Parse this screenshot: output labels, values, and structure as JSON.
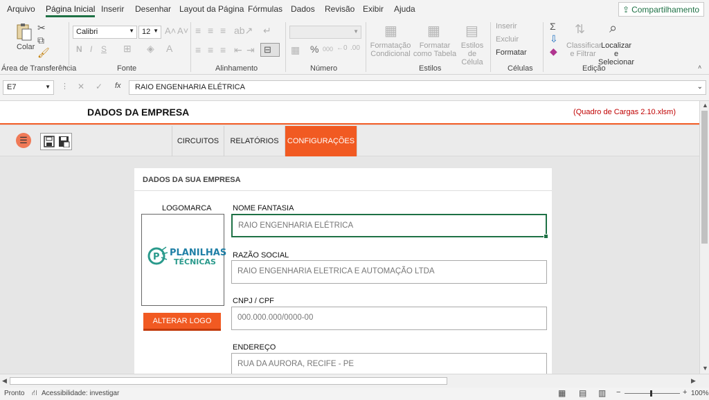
{
  "ribbon_tabs": [
    "Arquivo",
    "Página Inicial",
    "Inserir",
    "Desenhar",
    "Layout da Página",
    "Fórmulas",
    "Dados",
    "Revisão",
    "Exibir",
    "Ajuda"
  ],
  "share_label": "Compartilhamento",
  "clipboard": {
    "paste": "Colar",
    "group": "Área de Transferência"
  },
  "font": {
    "name": "Calibri",
    "size": "12",
    "group": "Fonte",
    "bold": "N",
    "italic": "I",
    "underline": "S"
  },
  "alignment": {
    "group": "Alinhamento"
  },
  "number": {
    "group": "Número",
    "percent": "%",
    "thousands": "000"
  },
  "styles": {
    "group": "Estilos",
    "conditional": "Formatação Condicional",
    "table": "Formatar como Tabela",
    "cell_styles": "Estilos de Célula"
  },
  "cells": {
    "group": "Células",
    "insert": "Inserir",
    "delete": "Excluir",
    "format": "Formatar"
  },
  "editing": {
    "group": "Edição",
    "sort": "Classificar e Filtrar",
    "find": "Localizar e Selecionar"
  },
  "formula_bar": {
    "cell": "E7",
    "fx": "fx",
    "value": "RAIO ENGENHARIA ELÉTRICA"
  },
  "sheet": {
    "title": "DADOS DA EMPRESA",
    "file_name": "(Quadro de Cargas 2.10.xlsm)",
    "nav_tabs": [
      "CIRCUITOS",
      "RELATÓRIOS",
      "CONFIGURAÇÕES"
    ],
    "active_tab": "CONFIGURAÇÕES",
    "card_title": "DADOS DA SUA EMPRESA",
    "logo_label": "LOGOMARCA",
    "logo_text_1": "PLANILHAS",
    "logo_text_2": "TÉCNICAS",
    "alter_logo": "ALTERAR LOGO",
    "fields": [
      {
        "label": "NOME FANTASIA",
        "value": "RAIO ENGENHARIA ELÉTRICA"
      },
      {
        "label": "RAZÃO SOCIAL",
        "value": "RAIO ENGENHARIA ELETRICA E AUTOMAÇÃO LTDA"
      },
      {
        "label": "CNPJ / CPF",
        "value": "000.000.000/0000-00"
      },
      {
        "label": "ENDEREÇO",
        "value": "RUA DA AURORA, RECIFE - PE"
      }
    ]
  },
  "status": {
    "ready": "Pronto",
    "accessibility": "Acessibilidade: investigar",
    "zoom": "100%"
  },
  "colors": {
    "excel_green": "#1e7145",
    "accent_orange": "#f15a22",
    "file_red": "#c00000"
  }
}
